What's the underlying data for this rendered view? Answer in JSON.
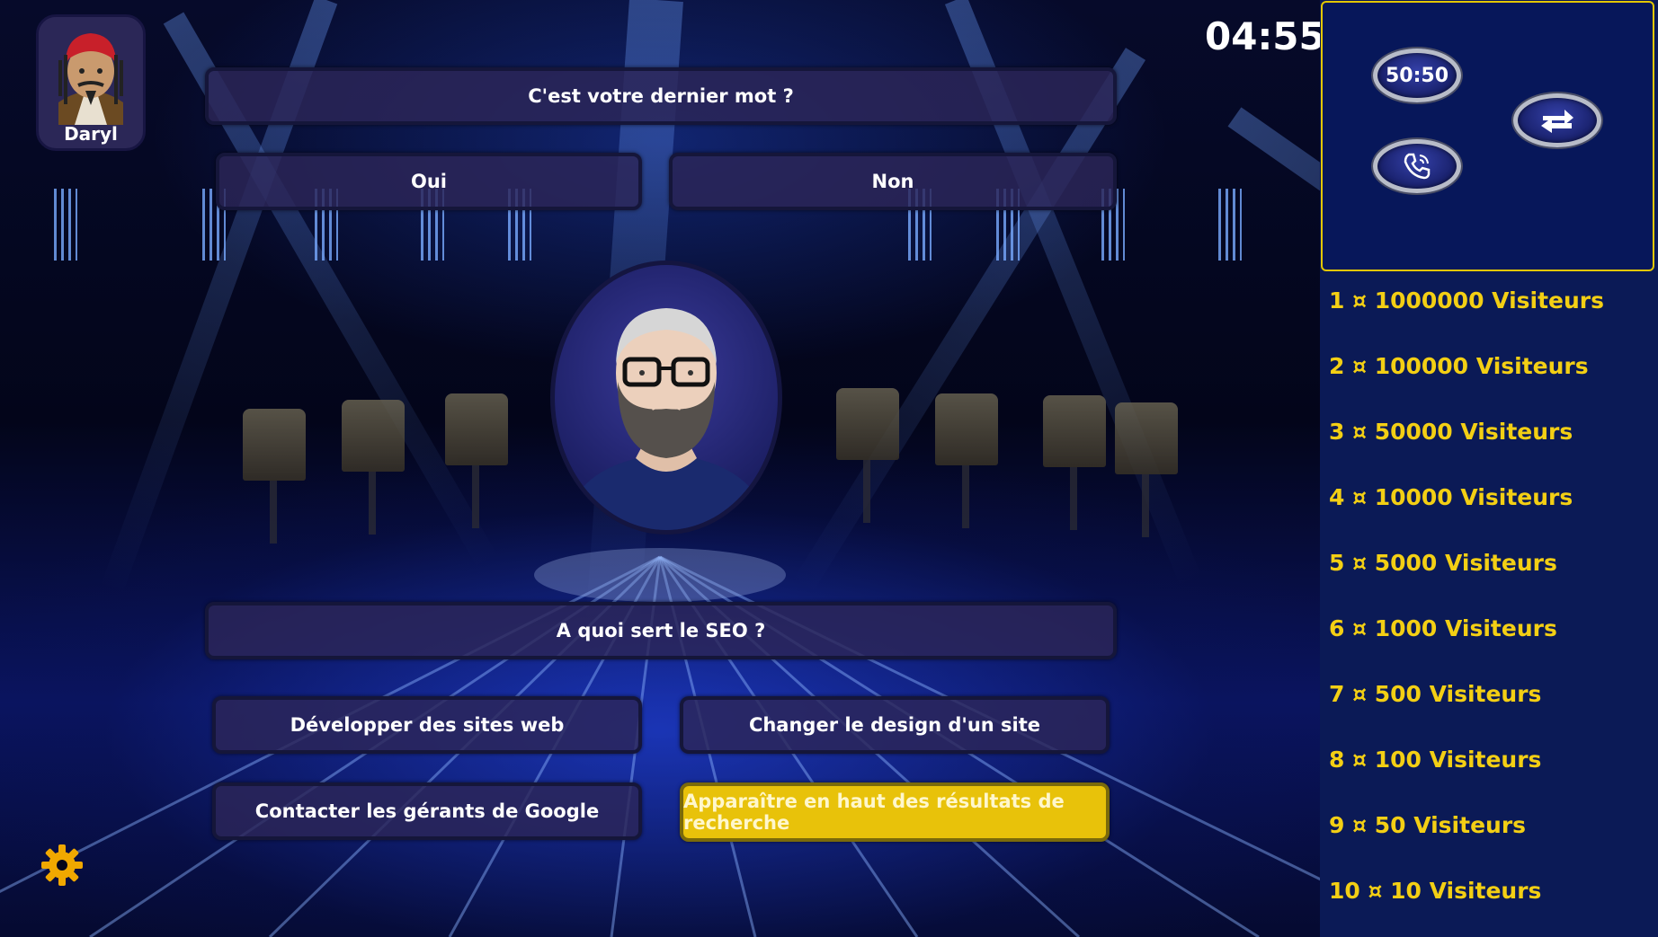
{
  "player": {
    "name": "Daryl"
  },
  "timer": "04:55",
  "confirm": {
    "question": "C'est votre dernier mot ?",
    "yes_label": "Oui",
    "no_label": "Non"
  },
  "question": {
    "text": "A quoi sert le SEO ?",
    "answers": [
      {
        "label": "Développer des sites web",
        "selected": false
      },
      {
        "label": "Changer le design d'un site",
        "selected": false
      },
      {
        "label": "Contacter les gérants de Google",
        "selected": false
      },
      {
        "label": "Apparaître en haut des résultats de recherche",
        "selected": true
      }
    ]
  },
  "lifelines": {
    "fifty_fifty_label": "50:50",
    "phone_icon": "phone-icon",
    "switch_icon": "switch-arrows-icon"
  },
  "prize_ladder": [
    "1 ¤ 1000000 Visiteurs",
    "2 ¤ 100000 Visiteurs",
    "3 ¤ 50000 Visiteurs",
    "4 ¤ 10000 Visiteurs",
    "5 ¤ 5000 Visiteurs",
    "6 ¤ 1000 Visiteurs",
    "7 ¤ 500 Visiteurs",
    "8 ¤ 100 Visiteurs",
    "9 ¤ 50 Visiteurs",
    "10 ¤ 10 Visiteurs"
  ],
  "colors": {
    "gold": "#f3cf14",
    "panel": "#2c2658",
    "selected": "#e8c20a",
    "sidebar": "#0b1a56"
  },
  "settings_icon": "gear-icon"
}
